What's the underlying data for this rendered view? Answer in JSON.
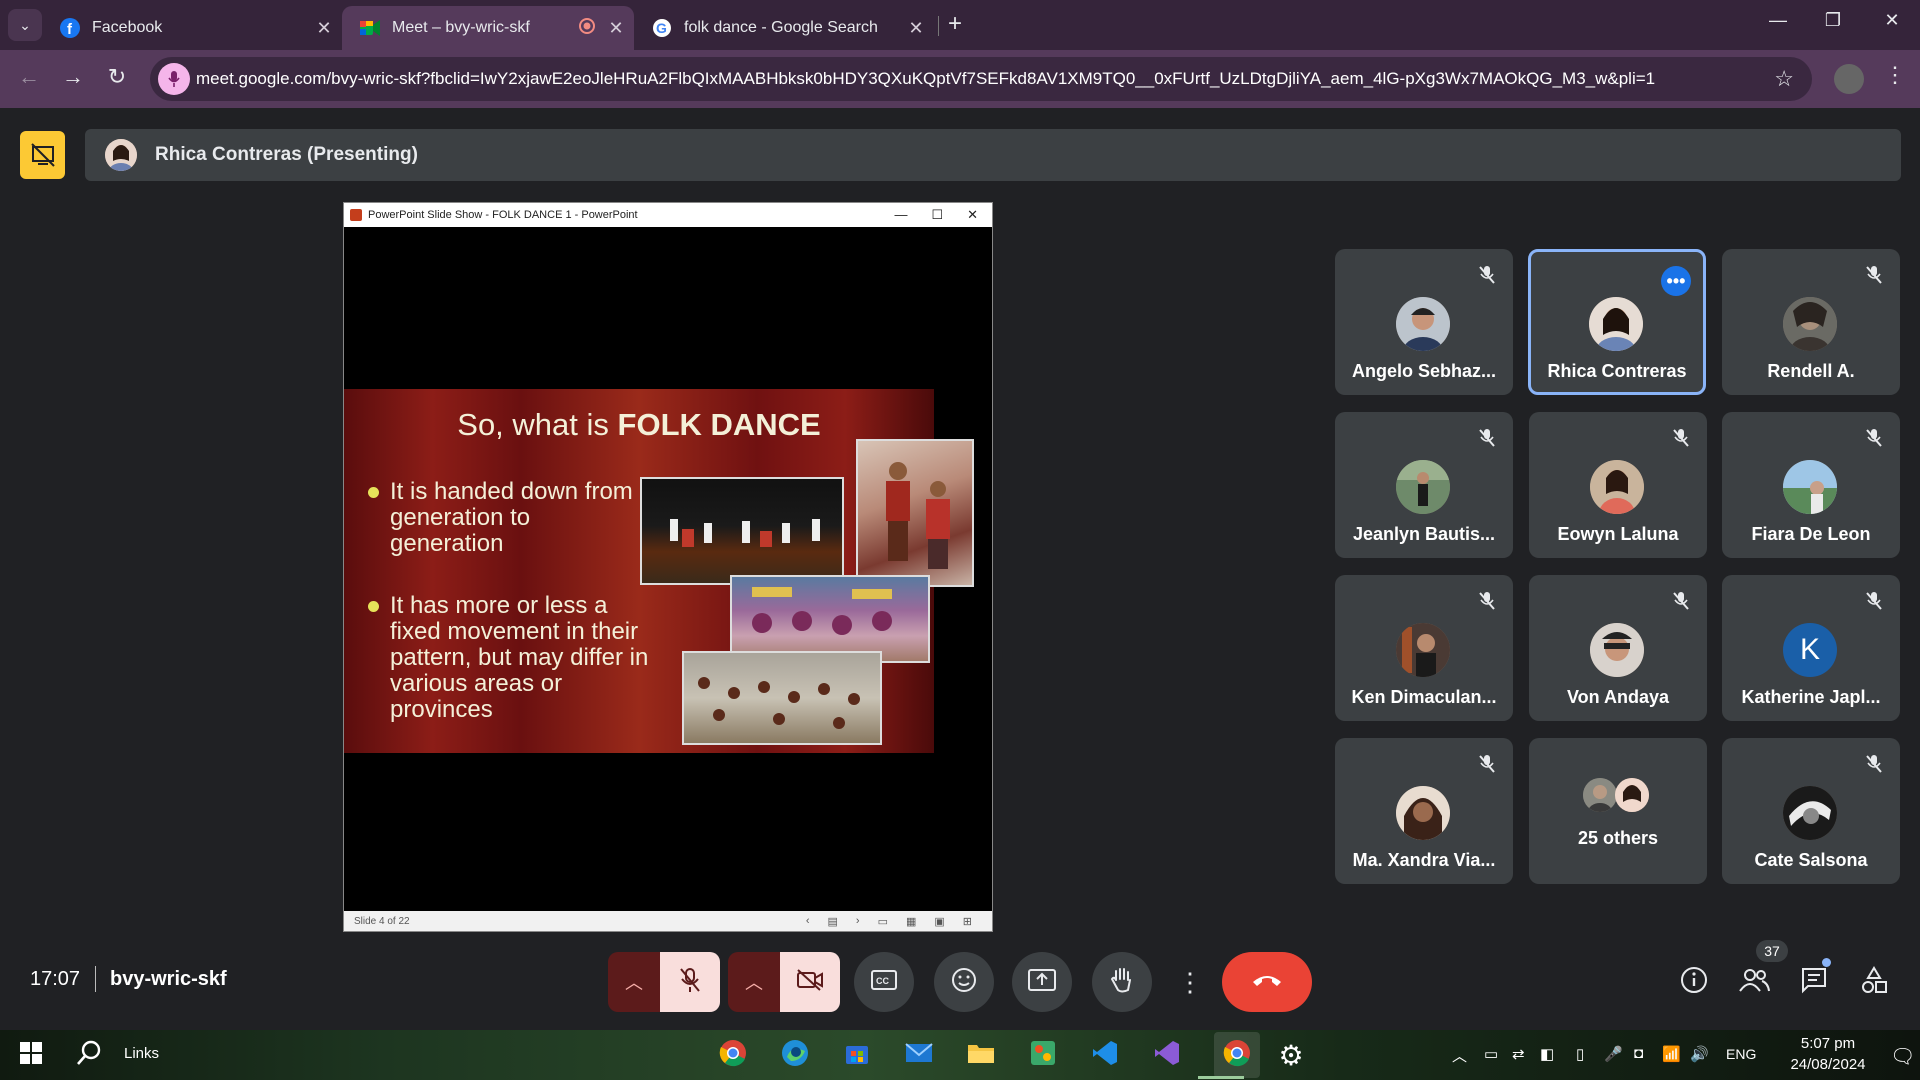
{
  "browser": {
    "tabs": [
      {
        "title": "Facebook",
        "close": "✕"
      },
      {
        "title": "Meet – bvy-wric-skf",
        "close": "✕"
      },
      {
        "title": "folk dance - Google Search",
        "close": "✕"
      }
    ],
    "new_tab": "+",
    "url": "meet.google.com/bvy-wric-skf?fbclid=IwY2xjawE2eoJleHRuA2FlbQIxMAABHbksk0bHDY3QXuKQptVf7SEFkd8AV1XM9TQ0__0xFUrtf_UzLDtgDjliYA_aem_4lG-pXg3Wx7MAOkQG_M3_w&pli=1"
  },
  "meet": {
    "presenting_label": "Rhica Contreras (Presenting)",
    "time": "17:07",
    "meeting_code": "bvy-wric-skf",
    "people_count": "37",
    "colors": {
      "end_call": "#ea4335",
      "active_border": "#8ab4f8",
      "present_tile": "#fcc934"
    }
  },
  "slideshow": {
    "window_title": "PowerPoint Slide Show  -  FOLK DANCE 1 - PowerPoint",
    "slide_title_prefix": "So, what is ",
    "slide_title_bold": "FOLK DANCE",
    "bullets": [
      "It is handed down from generation to generation",
      "It has more or less a fixed movement in their pattern, but may differ in various areas or provinces"
    ],
    "status": "Slide 4 of 22"
  },
  "participants": [
    {
      "name": "Angelo Sebhaz...",
      "muted": true
    },
    {
      "name": "Rhica Contreras",
      "muted": false,
      "active": true
    },
    {
      "name": "Rendell A.",
      "muted": true
    },
    {
      "name": "Jeanlyn Bautis...",
      "muted": true
    },
    {
      "name": "Eowyn Laluna",
      "muted": true
    },
    {
      "name": "Fiara De Leon",
      "muted": true
    },
    {
      "name": "Ken Dimaculan...",
      "muted": true
    },
    {
      "name": "Von Andaya",
      "muted": true
    },
    {
      "name": "Katherine Japl...",
      "muted": true,
      "initial": "K"
    },
    {
      "name": "Ma. Xandra Via...",
      "muted": true
    },
    {
      "name": "25 others",
      "muted": false
    },
    {
      "name": "Cate Salsona",
      "muted": true
    }
  ],
  "taskbar": {
    "search_label": "Links",
    "lang": "ENG",
    "time": "5:07 pm",
    "date": "24/08/2024"
  }
}
